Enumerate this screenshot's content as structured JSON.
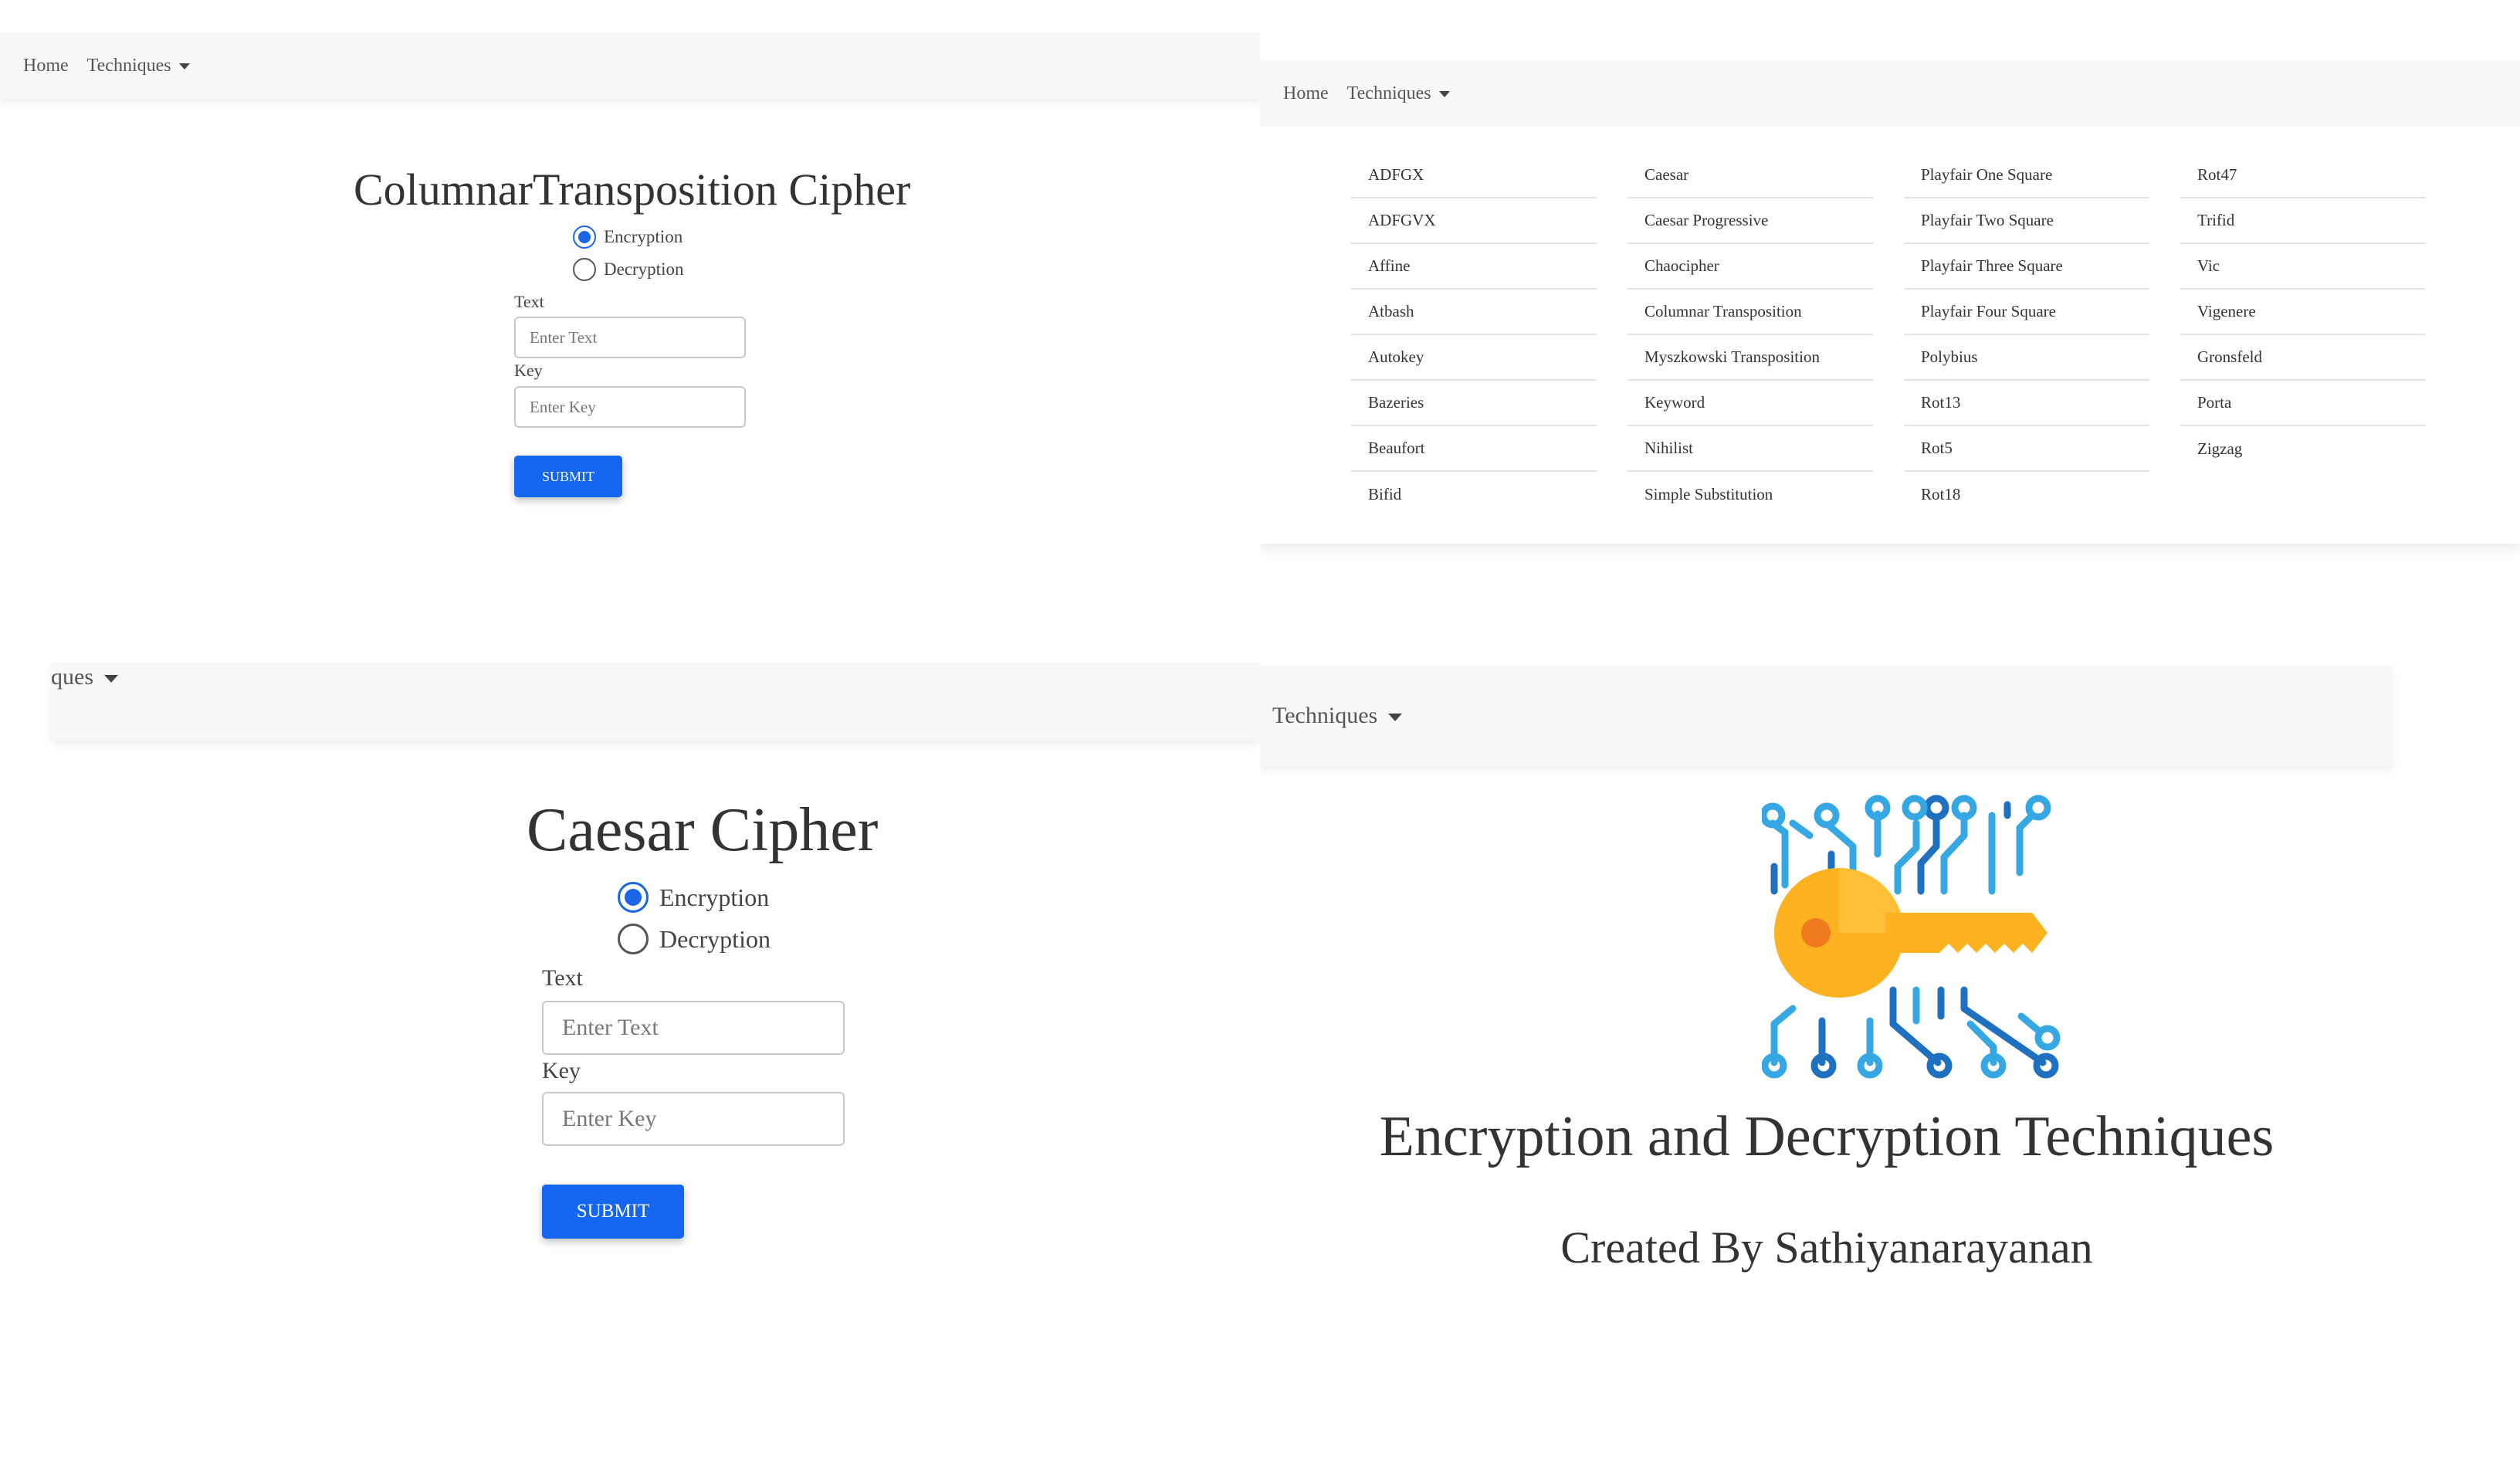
{
  "panel_columnar": {
    "nav": {
      "home": "Home",
      "techniques": "Techniques"
    },
    "title": "ColumnarTransposition Cipher",
    "radio_encryption": "Encryption",
    "radio_decryption": "Decryption",
    "text_label": "Text",
    "text_placeholder": "Enter Text",
    "key_label": "Key",
    "key_placeholder": "Enter Key",
    "submit": "SUBMIT"
  },
  "panel_menu": {
    "nav": {
      "home": "Home",
      "techniques": "Techniques"
    },
    "columns": [
      [
        "ADFGX",
        "ADFGVX",
        "Affine",
        "Atbash",
        "Autokey",
        "Bazeries",
        "Beaufort",
        "Bifid"
      ],
      [
        "Caesar",
        "Caesar Progressive",
        "Chaocipher",
        "Columnar Transposition",
        "Myszkowski Transposition",
        "Keyword",
        "Nihilist",
        "Simple Substitution"
      ],
      [
        "Playfair One Square",
        "Playfair Two Square",
        "Playfair Three Square",
        "Playfair Four Square",
        "Polybius",
        "Rot13",
        "Rot5",
        "Rot18"
      ],
      [
        "Rot47",
        "Trifid",
        "Vic",
        "Vigenere",
        "Gronsfeld",
        "Porta",
        "Zigzag"
      ]
    ]
  },
  "panel_caesar": {
    "nav": {
      "techniques_partial": "ques"
    },
    "title": "Caesar Cipher",
    "radio_encryption": "Encryption",
    "radio_decryption": "Decryption",
    "text_label": "Text",
    "text_placeholder": "Enter Text",
    "key_label": "Key",
    "key_placeholder": "Enter Key",
    "submit": "SUBMIT"
  },
  "panel_home": {
    "nav": {
      "techniques": "Techniques"
    },
    "logo_icon": "key-circuit-icon",
    "title": "Encryption and Decryption Techniques",
    "subtitle": "Created By Sathiyanarayanan"
  },
  "colors": {
    "accent": "#1466f0",
    "navbar_bg": "#f8f8f8",
    "key_gold": "#ffb21f",
    "circuit_blue": "#2f9ee0"
  }
}
